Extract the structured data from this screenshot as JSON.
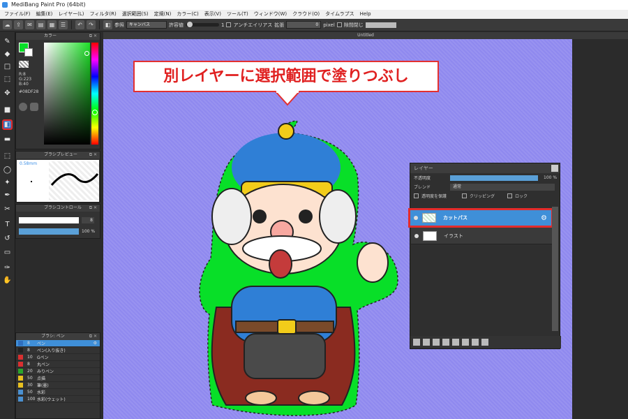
{
  "window": {
    "title": "MediBang Paint Pro (64bit)"
  },
  "menu": [
    "ファイル(F)",
    "編集(E)",
    "レイヤー(L)",
    "フィルタ(R)",
    "選択範囲(S)",
    "定規(N)",
    "カラー(C)",
    "表示(V)",
    "ツール(T)",
    "ウィンドウ(W)",
    "クラウド(O)",
    "タイムラプス",
    "Help"
  ],
  "toolbar": {
    "ref_label": "参照",
    "ref_value": "キャンバス",
    "tolerance_label": "許容値",
    "tolerance_value": "1",
    "antialias_label": "アンチエイリアス",
    "expand_label": "拡張",
    "expand_value": "0",
    "expand_unit": "pixel",
    "close_gap_label": "隙間閉じ"
  },
  "color_panel": {
    "title": "カラー",
    "r": "R:8",
    "g": "G:223",
    "b": "B:40",
    "hex": "#08DF28",
    "foreground": "#08DF28"
  },
  "brush_preview": {
    "title": "ブラシプレビュー",
    "size": "0.58mm"
  },
  "brush_control": {
    "title": "ブラシコントロール",
    "size_value": "8",
    "opacity_value": "100 %"
  },
  "brush_list": {
    "title": "ブラシ: ペン",
    "items": [
      {
        "size": "8",
        "name": "ペン",
        "color": "#2f6fbf",
        "selected": true
      },
      {
        "size": "8",
        "name": "ペン(入り抜き)",
        "color": "#222222"
      },
      {
        "size": "10",
        "name": "Gペン",
        "color": "#d93030"
      },
      {
        "size": "8",
        "name": "丸ペン",
        "color": "#d93030"
      },
      {
        "size": "20",
        "name": "みりペン",
        "color": "#2aa52a"
      },
      {
        "size": "50",
        "name": "点描",
        "color": "#e8c020"
      },
      {
        "size": "30",
        "name": "筆(墨)",
        "color": "#e8c020"
      },
      {
        "size": "50",
        "name": "水彩",
        "color": "#4a90d0"
      },
      {
        "size": "100",
        "name": "水彩(ウェット)",
        "color": "#4a90d0"
      }
    ]
  },
  "canvas": {
    "tab_title": "Untitled",
    "callout": "別レイヤーに選択範囲で塗りつぶし",
    "background": "#8f89ef",
    "fill_color": "#08DF28"
  },
  "layer_panel": {
    "title": "レイヤー",
    "opacity_label": "不透明度",
    "opacity_value": "100 %",
    "blend_label": "ブレンド",
    "blend_value": "通常",
    "protect_label": "透明度を保護",
    "clipping_label": "クリッピング",
    "lock_label": "ロック",
    "layers": [
      {
        "name": "カットパス",
        "selected": true
      },
      {
        "name": "イラスト",
        "selected": false
      }
    ]
  }
}
